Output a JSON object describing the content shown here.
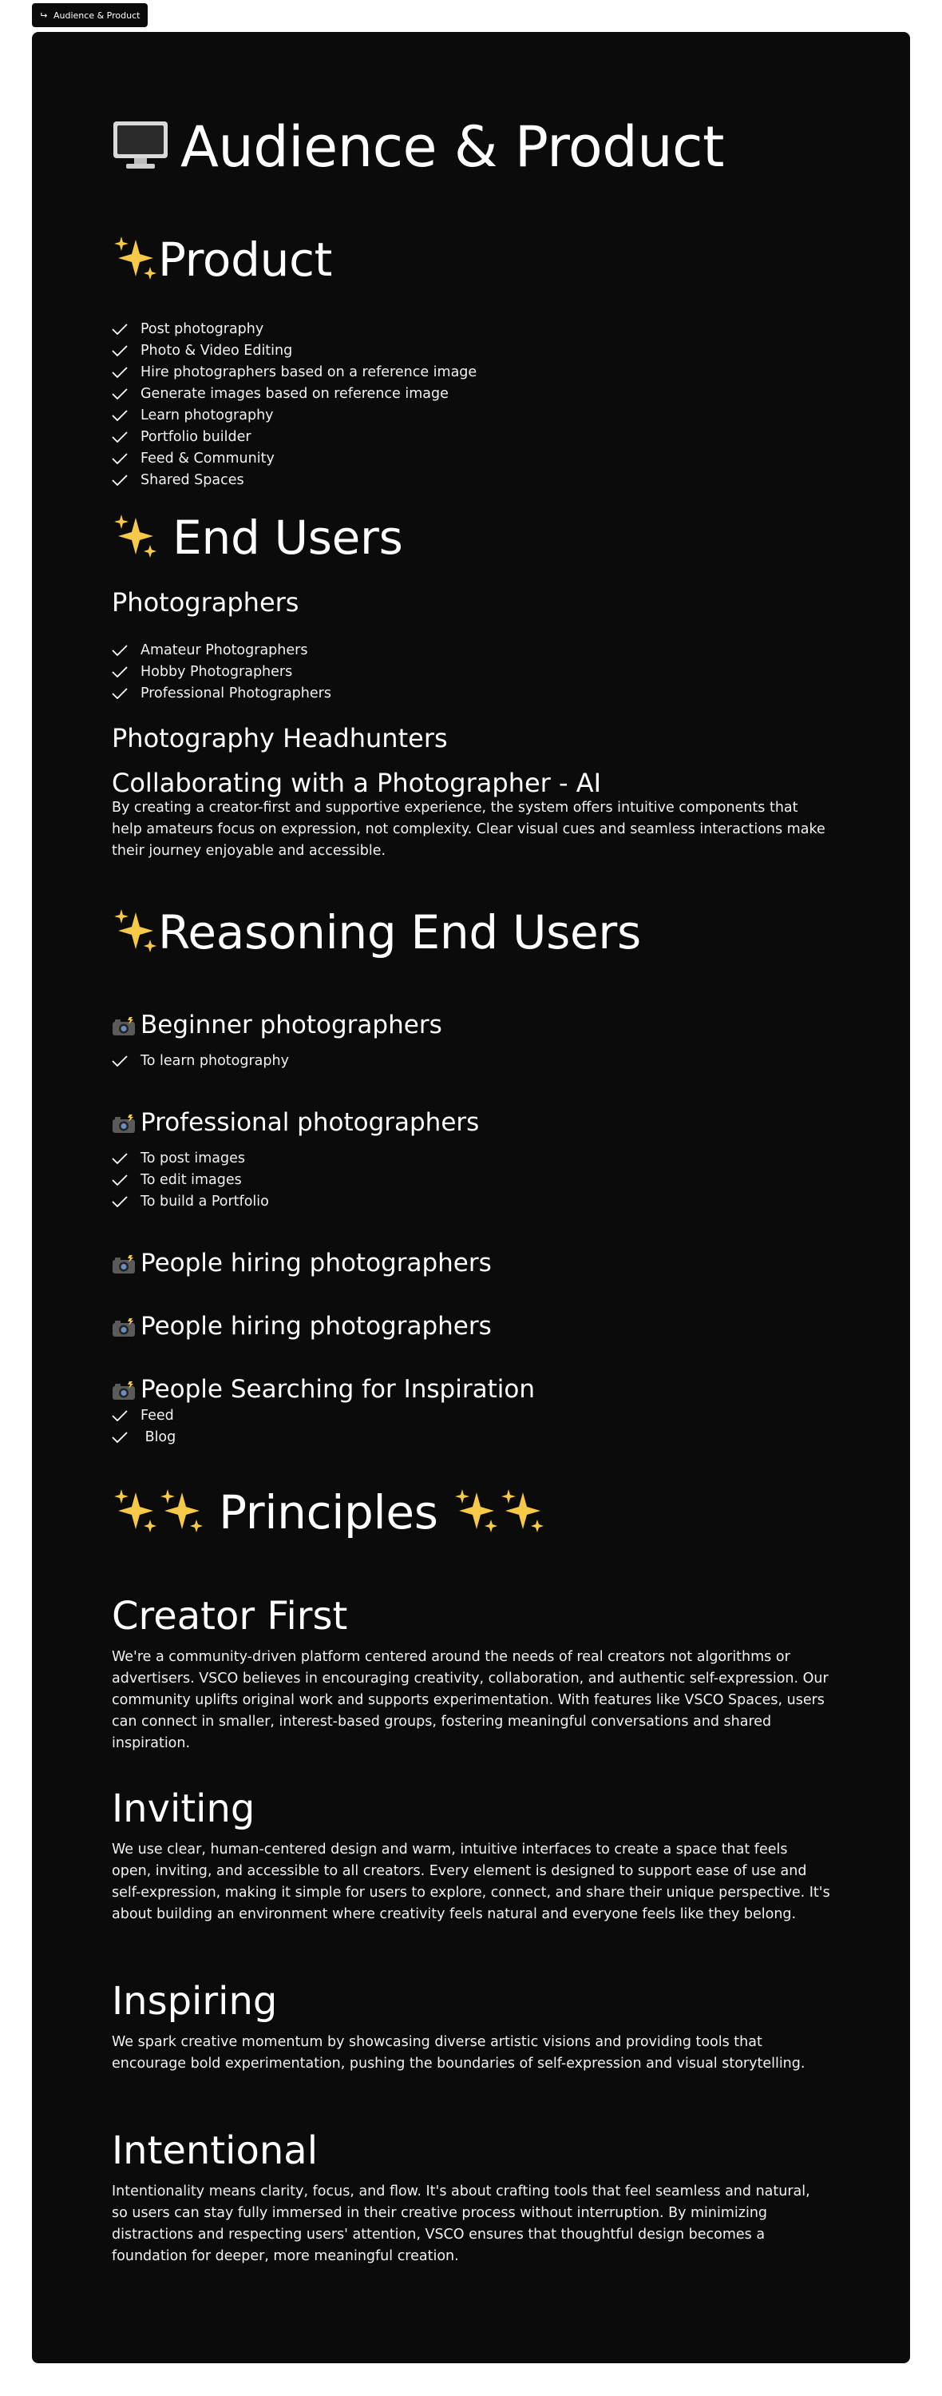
{
  "tab": {
    "label": "Audience & Product"
  },
  "page": {
    "title": "Audience & Product"
  },
  "sections": {
    "product": {
      "heading": "Product",
      "items": [
        "Post photography",
        "Photo & Video Editing",
        "Hire photographers based on a reference image",
        "Generate images based on reference image",
        "Learn photography",
        "Portfolio builder",
        "Feed & Community",
        "Shared Spaces"
      ]
    },
    "end_users": {
      "heading": "End Users",
      "photographers": {
        "heading": "Photographers",
        "items": [
          "Amateur Photographers",
          "Hobby Photographers",
          "Professional Photographers"
        ]
      },
      "headhunters": {
        "heading": "Photography Headhunters"
      },
      "collab": {
        "heading": "Collaborating with a Photographer - AI",
        "text": "By creating a creator-first and supportive experience, the system offers intuitive components that help amateurs focus on expression, not complexity. Clear visual cues and seamless interactions make their journey enjoyable and accessible."
      }
    },
    "reasoning": {
      "heading": "Reasoning End Users",
      "groups": [
        {
          "heading": "Beginner photographers",
          "items": [
            "To learn photography"
          ]
        },
        {
          "heading": "Professional photographers",
          "items": [
            "To post images",
            "To edit images",
            "To build a Portfolio"
          ]
        },
        {
          "heading": "People hiring photographers",
          "items": []
        },
        {
          "heading": "People hiring photographers",
          "items": []
        },
        {
          "heading": "People Searching for Inspiration",
          "items": [
            "Feed",
            " Blog"
          ]
        }
      ]
    },
    "principles": {
      "heading": "Principles",
      "items": [
        {
          "heading": "Creator First",
          "text": "We're a community-driven platform centered around the needs of real creators not algorithms or advertisers. VSCO believes in encouraging creativity, collaboration, and authentic self-expression. Our community uplifts original work and supports experimentation. With features like VSCO Spaces, users can connect in smaller, interest-based groups, fostering meaningful conversations and shared inspiration."
        },
        {
          "heading": "Inviting",
          "text": "We use clear, human-centered design and warm, intuitive interfaces to create a space that feels open, inviting, and accessible to all creators. Every element is designed to support ease of use and self-expression, making it simple for users to explore, connect, and share their unique perspective. It's about building an environment where creativity feels natural and everyone feels like they belong."
        },
        {
          "heading": "Inspiring",
          "text": "We spark creative momentum by showcasing diverse artistic visions and providing tools that encourage bold experimentation, pushing the boundaries of self-expression and visual storytelling."
        },
        {
          "heading": "Intentional",
          "text": "Intentionality means clarity, focus, and flow. It's about crafting tools that feel seamless and natural, so users can stay fully immersed in their creative process without interruption. By minimizing distractions and respecting users' attention, VSCO ensures that thoughtful design becomes a foundation for deeper, more meaningful creation."
        }
      ]
    }
  },
  "icons": {
    "page_icon": "desktop-computer-icon",
    "section_icon": "sparkles-icon",
    "group_icon": "camera-with-flash-icon",
    "list_icon": "checkmark-icon",
    "tab_icon": "return-arrow-icon"
  },
  "colors": {
    "background": "#0b0b0b",
    "text": "#ffffff",
    "sparkle": "#f7c948"
  }
}
